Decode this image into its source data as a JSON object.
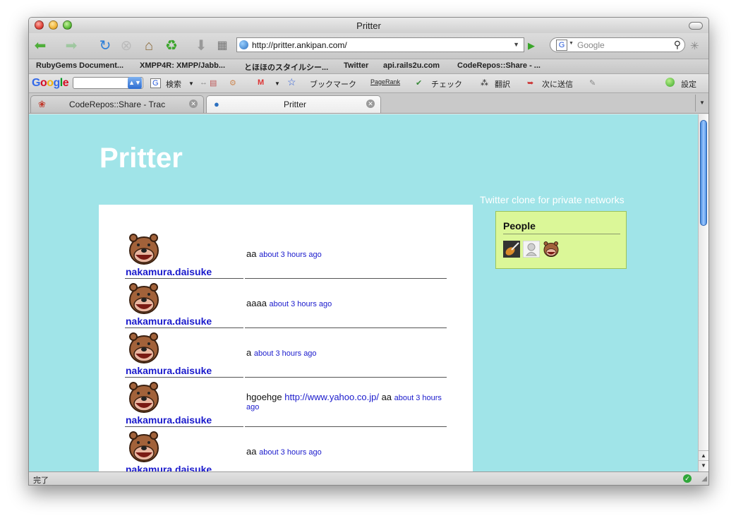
{
  "window": {
    "title": "Pritter"
  },
  "navigation": {
    "url": "http://pritter.ankipan.com/",
    "search_placeholder": "Google"
  },
  "bookmarks": [
    "RubyGems Document...",
    "XMPP4R: XMPP/Jabb...",
    "とほほのスタイルシー...",
    "Twitter",
    "api.rails2u.com",
    "CodeRepos::Share - ..."
  ],
  "google_toolbar": {
    "logo": "Google",
    "search": "検索",
    "bookmark": "ブックマーク",
    "pagerank": "PageRank",
    "check": "チェック",
    "translate": "翻訳",
    "send": "次に送信",
    "settings": "設定"
  },
  "tabs": [
    {
      "label": "CodeRepos::Share - Trac",
      "active": false
    },
    {
      "label": "Pritter",
      "active": true
    }
  ],
  "page": {
    "site_title": "Pritter",
    "tagline": "Twitter clone for private networks",
    "people_title": "People",
    "entries": [
      {
        "user": "nakamura.daisuke",
        "text": "aa",
        "link": "",
        "after": "",
        "time": "about 3 hours ago"
      },
      {
        "user": "nakamura.daisuke",
        "text": "aaaa",
        "link": "",
        "after": "",
        "time": "about 3 hours ago"
      },
      {
        "user": "nakamura.daisuke",
        "text": "a",
        "link": "",
        "after": "",
        "time": "about 3 hours ago"
      },
      {
        "user": "nakamura.daisuke",
        "text": "hgoehge",
        "link": "http://www.yahoo.co.jp/",
        "after": "aa",
        "time": "about 3 hours ago"
      },
      {
        "user": "nakamura.daisuke",
        "text": "aa",
        "link": "",
        "after": "",
        "time": "about 3 hours ago"
      }
    ]
  },
  "status": {
    "text": "完了"
  },
  "colors": {
    "page_background": "#a0e4e8",
    "people_box": "#dbf798",
    "link": "#1a1acc"
  }
}
